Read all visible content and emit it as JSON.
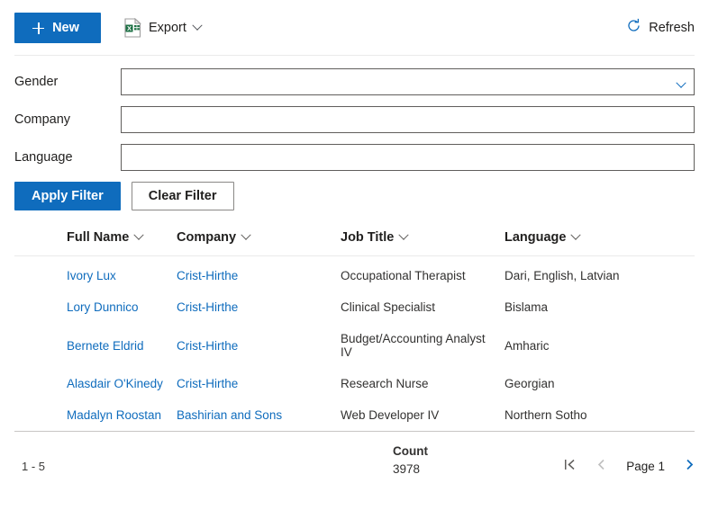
{
  "toolbar": {
    "new_label": "New",
    "new_icon": "plus-icon",
    "export_label": "Export",
    "export_icon": "excel-file-icon",
    "export_chevron": "chevron-down-icon",
    "refresh_label": "Refresh",
    "refresh_icon": "refresh-icon",
    "accent_color": "#0f6cbd"
  },
  "filters": {
    "rows": [
      {
        "label": "Gender",
        "value": "",
        "placeholder": "",
        "type": "select"
      },
      {
        "label": "Company",
        "value": "",
        "placeholder": "",
        "type": "text"
      },
      {
        "label": "Language",
        "value": "",
        "placeholder": "",
        "type": "text"
      }
    ],
    "apply_label": "Apply Filter",
    "clear_label": "Clear Filter"
  },
  "table": {
    "columns": [
      {
        "label": "Full Name",
        "sort_icon": "chevron-down-icon"
      },
      {
        "label": "Company",
        "sort_icon": "chevron-down-icon"
      },
      {
        "label": "Job Title",
        "sort_icon": "chevron-down-icon"
      },
      {
        "label": "Language",
        "sort_icon": "chevron-down-icon"
      }
    ],
    "rows": [
      {
        "full_name": "Ivory Lux",
        "company": "Crist-Hirthe",
        "job_title": "Occupational Therapist",
        "language": "Dari, English, Latvian"
      },
      {
        "full_name": "Lory Dunnico",
        "company": "Crist-Hirthe",
        "job_title": "Clinical Specialist",
        "language": "Bislama"
      },
      {
        "full_name": "Bernete Eldrid",
        "company": "Crist-Hirthe",
        "job_title": "Budget/Accounting Analyst IV",
        "language": "Amharic"
      },
      {
        "full_name": "Alasdair O'Kinedy",
        "company": "Crist-Hirthe",
        "job_title": "Research Nurse",
        "language": "Georgian"
      },
      {
        "full_name": "Madalyn Roostan",
        "company": "Bashirian and Sons",
        "job_title": "Web Developer IV",
        "language": "Northern Sotho"
      }
    ],
    "link_color": "#0f6cbd"
  },
  "footer": {
    "count_label": "Count",
    "count_value": "3978",
    "range_text": "1 - 5",
    "page_label": "Page 1",
    "first_icon": "first-page-icon",
    "prev_icon": "chevron-left-icon",
    "next_icon": "chevron-right-icon"
  }
}
